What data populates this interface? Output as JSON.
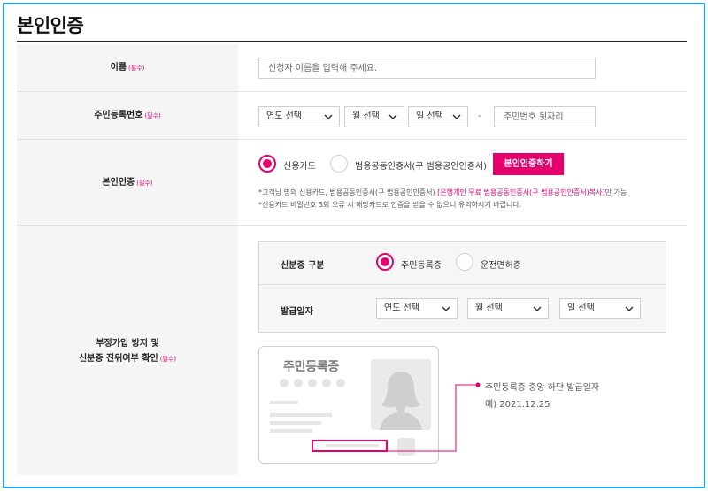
{
  "page": {
    "title": "본인인증"
  },
  "colors": {
    "accent": "#e5006e",
    "frame": "#1ea0e6",
    "label_bg": "#f5f5f5"
  },
  "name_row": {
    "label": "이름",
    "required": "(필수)",
    "placeholder": "신청자 이름을 입력해 주세요."
  },
  "rrn_row": {
    "label": "주민등록번호",
    "required": "(필수)",
    "year_select": "연도 선택",
    "month_select": "월 선택",
    "day_select": "일 선택",
    "separator": "-",
    "back_placeholder": "주민번호 뒷자리"
  },
  "auth_row": {
    "label": "본인인증",
    "required": "(필수)",
    "option_credit_card": "신용카드",
    "option_certificate": "범용공동인증서(구 범용공인인증서)",
    "selected": "신용카드",
    "auth_button": "본인인증하기",
    "note1_pre": "*고객님 명의 신용카드, 범용공동인증서(구 범용공인인증서)",
    "note1_highlight": "[은행개인 무료 범용공동인증서(구 범용공인인증서)복사]",
    "note1_post": "만 가능",
    "note2": "*신용카드 비밀번호 3회 오류 시 해당카드로 인증을 받을 수 없으니 유의하시기 바랍니다."
  },
  "id_row": {
    "label_line1": "부정가입 방지 및",
    "label_line2": "신분증 진위여부 확인",
    "required": "(필수)",
    "id_type_label": "신분증 구분",
    "option_resident_card": "주민등록증",
    "option_driver_license": "운전면허증",
    "selected": "주민등록증",
    "issue_date_label": "발급일자",
    "year_select": "연도 선택",
    "month_select": "월 선택",
    "day_select": "일 선택",
    "card_title": "주민등록증",
    "callout_line1": "주민등록증 중앙 하단 발급일자",
    "callout_line2": "예) 2021.12.25"
  },
  "icons": {
    "chevron": "chevron-down-icon",
    "silhouette": "person-silhouette-icon"
  }
}
